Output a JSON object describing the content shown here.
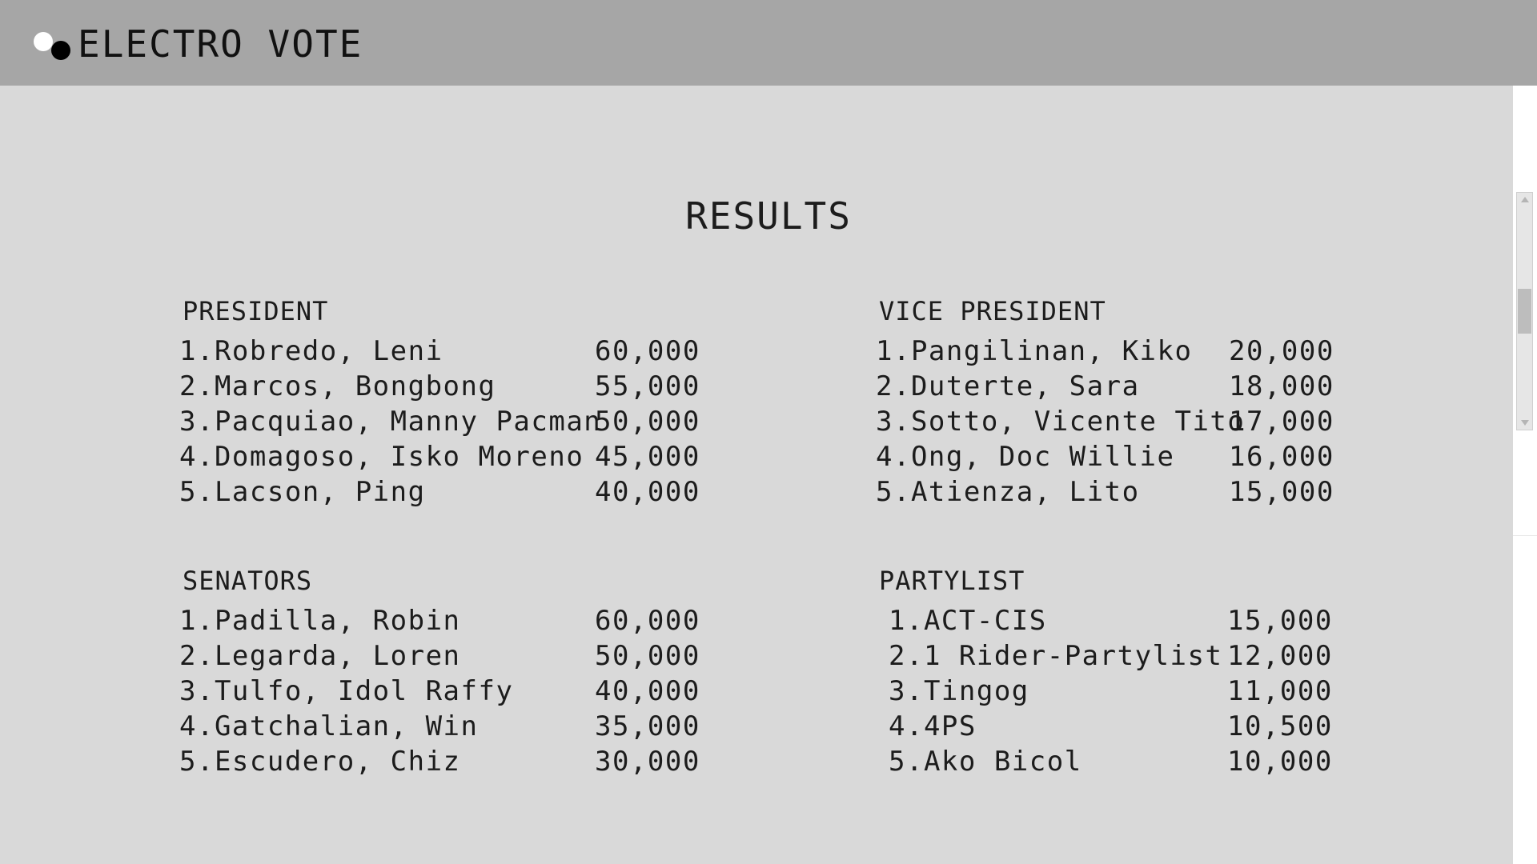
{
  "header": {
    "brand": "ELECTRO VOTE"
  },
  "page": {
    "title": "RESULTS"
  },
  "sections": {
    "president": {
      "title": "PRESIDENT",
      "rows": [
        {
          "name": "1.Robredo, Leni",
          "votes": "60,000"
        },
        {
          "name": "2.Marcos, Bongbong",
          "votes": "55,000"
        },
        {
          "name": "3.Pacquiao, Manny Pacman",
          "votes": "50,000"
        },
        {
          "name": "4.Domagoso, Isko Moreno",
          "votes": "45,000"
        },
        {
          "name": "5.Lacson, Ping",
          "votes": "40,000"
        }
      ]
    },
    "vice_president": {
      "title": "VICE PRESIDENT",
      "rows": [
        {
          "name": "1.Pangilinan, Kiko",
          "votes": "20,000"
        },
        {
          "name": "2.Duterte, Sara",
          "votes": "18,000"
        },
        {
          "name": "3.Sotto, Vicente Tito",
          "votes": "17,000"
        },
        {
          "name": "4.Ong, Doc Willie",
          "votes": "16,000"
        },
        {
          "name": "5.Atienza, Lito",
          "votes": "15,000"
        }
      ]
    },
    "senators": {
      "title": "SENATORS",
      "rows": [
        {
          "name": "1.Padilla, Robin",
          "votes": "60,000"
        },
        {
          "name": "2.Legarda, Loren",
          "votes": "50,000"
        },
        {
          "name": "3.Tulfo, Idol Raffy",
          "votes": "40,000"
        },
        {
          "name": "4.Gatchalian, Win",
          "votes": "35,000"
        },
        {
          "name": "5.Escudero, Chiz",
          "votes": "30,000"
        }
      ]
    },
    "partylist": {
      "title": "PARTYLIST",
      "rows": [
        {
          "name": "1.ACT-CIS",
          "votes": "15,000"
        },
        {
          "name": "2.1 Rider-Partylist",
          "votes": "12,000"
        },
        {
          "name": "3.Tingog",
          "votes": "11,000"
        },
        {
          "name": "4.4PS",
          "votes": "10,500"
        },
        {
          "name": "5.Ako Bicol",
          "votes": "10,000"
        }
      ]
    }
  },
  "colors": {
    "header_bg": "#a6a6a6",
    "content_bg": "#d9d9d9",
    "text": "#1c1c1c"
  },
  "icons": {
    "logo": "two-dots-logo-icon",
    "scroll_up": "scroll-up-arrow-icon",
    "scroll_down": "scroll-down-arrow-icon"
  }
}
